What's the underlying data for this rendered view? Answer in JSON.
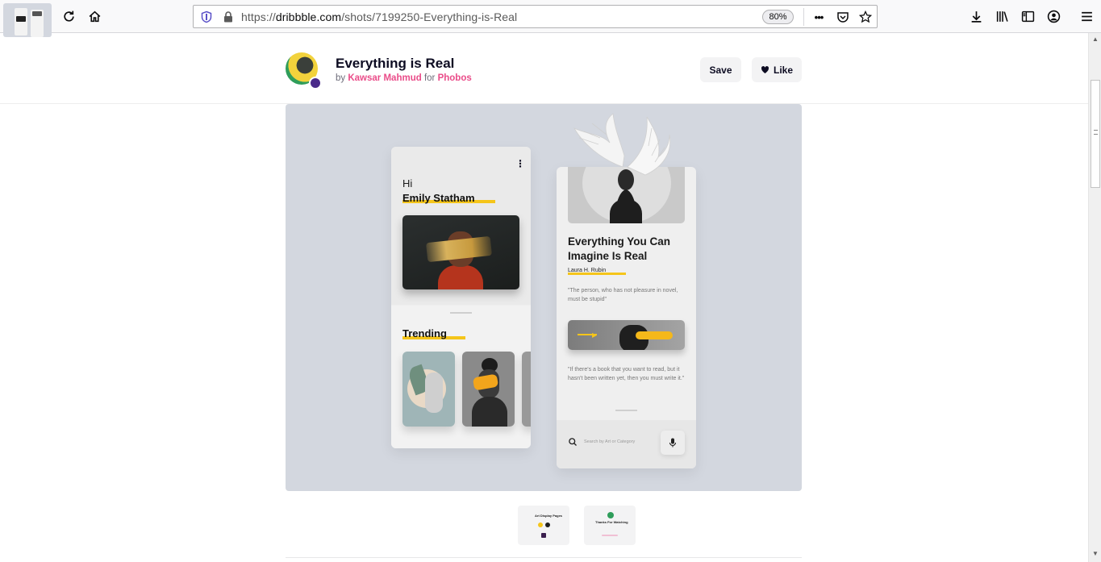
{
  "browser": {
    "url_prefix": "https://",
    "url_host": "dribbble.com",
    "url_path": "/shots/7199250-Everything-is-Real",
    "zoom": "80%",
    "overflow_menu": "•••"
  },
  "shot": {
    "title": "Everything is Real",
    "by_label": "by",
    "author": "Kawsar Mahmud",
    "for_label": "for",
    "team": "Phobos",
    "save_label": "Save",
    "like_label": "Like"
  },
  "mockup": {
    "left_phone": {
      "menu": "⋮",
      "greeting": "Hi",
      "name": "Emily Statham",
      "section": "Trending"
    },
    "right_phone": {
      "headline": "Everything You Can Imagine Is Real",
      "author": "Laura H. Rubin",
      "quote1": "\"The person, who has not pleasure in novel, must be stupid\"",
      "quote2": "\"If there's a book that you want to read, but it hasn't been written yet, then you must write it.\"",
      "search_placeholder": "Search by Art or Category"
    }
  },
  "thumbnails": {
    "t2_title": "Art Display Pages",
    "t3_title": "Thanks For Watching"
  },
  "colors": {
    "accent": "#ea4c89",
    "highlight": "#f5c51a",
    "media_bg": "#d3d7df"
  }
}
